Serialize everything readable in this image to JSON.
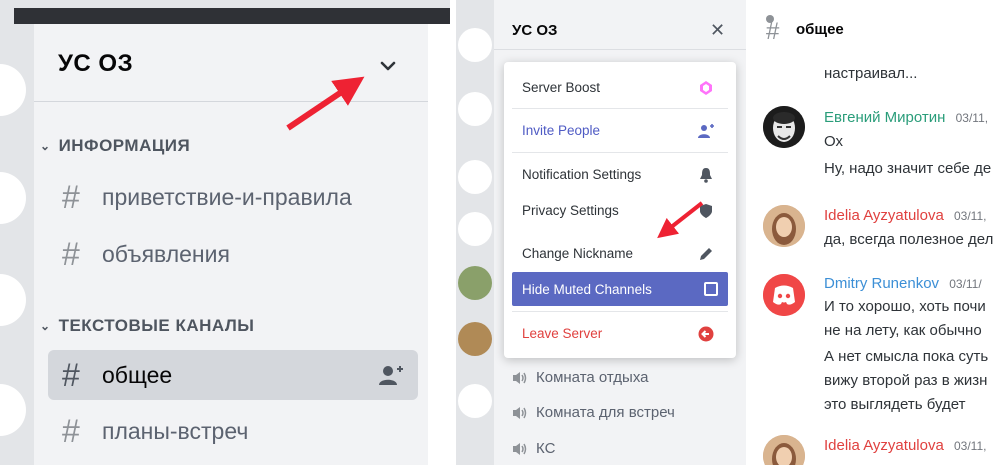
{
  "left": {
    "server_title": "УС ОЗ",
    "categories": [
      {
        "label": "ИНФОРМАЦИЯ"
      },
      {
        "label": "ТЕКСТОВЫЕ КАНАЛЫ"
      }
    ],
    "channels": [
      {
        "label": "приветствие-и-правила"
      },
      {
        "label": "объявления"
      },
      {
        "label": "общее"
      },
      {
        "label": "планы-встреч"
      }
    ]
  },
  "middle": {
    "server_title": "УС ОЗ",
    "close_glyph": "✕",
    "voice_channels": [
      {
        "label": "Комната отдыха"
      },
      {
        "label": "Комната для встреч"
      },
      {
        "label": "КС"
      }
    ],
    "menu": [
      {
        "label": "Server Boost",
        "icon": "boost-icon",
        "color": "#ff73fa"
      },
      {
        "label": "Invite People",
        "icon": "invite-icon",
        "color": "#5b69c2"
      },
      {
        "label": "Notification Settings",
        "icon": "bell-icon"
      },
      {
        "label": "Privacy Settings",
        "icon": "shield-icon"
      },
      {
        "label": "Change Nickname",
        "icon": "pencil-icon"
      },
      {
        "label": "Hide Muted Channels",
        "icon": "checkbox-icon",
        "selected": true
      },
      {
        "label": "Leave Server",
        "icon": "leave-icon",
        "color": "#e0413f"
      }
    ]
  },
  "chat": {
    "channel_title": "общее",
    "top_line": "настраивал...",
    "messages": [
      {
        "author": "Евгений Миротин",
        "date": "03/11,",
        "author_color": "#2a9d7a",
        "lines": [
          "Ох",
          "Ну, надо значит себе де"
        ]
      },
      {
        "author": "Idelia Ayzyatulova",
        "date": "03/11,",
        "author_color": "#e0413f",
        "lines": [
          "да, всегда полезное дел"
        ]
      },
      {
        "author": "Dmitry Runenkov",
        "date": "03/11/",
        "author_color": "#3c8fd6",
        "lines": [
          "И то хорошо, хоть почи",
          "не на лету, как обычно",
          "А нет смысла пока суть",
          "вижу второй раз в жизн",
          "это выглядеть будет"
        ]
      },
      {
        "author": "Idelia Ayzyatulova",
        "date": "03/11,",
        "author_color": "#e0413f",
        "lines": []
      }
    ]
  },
  "colors": {
    "accent": "#5b69c2",
    "danger": "#e0413f",
    "arrow": "#ee2233"
  }
}
